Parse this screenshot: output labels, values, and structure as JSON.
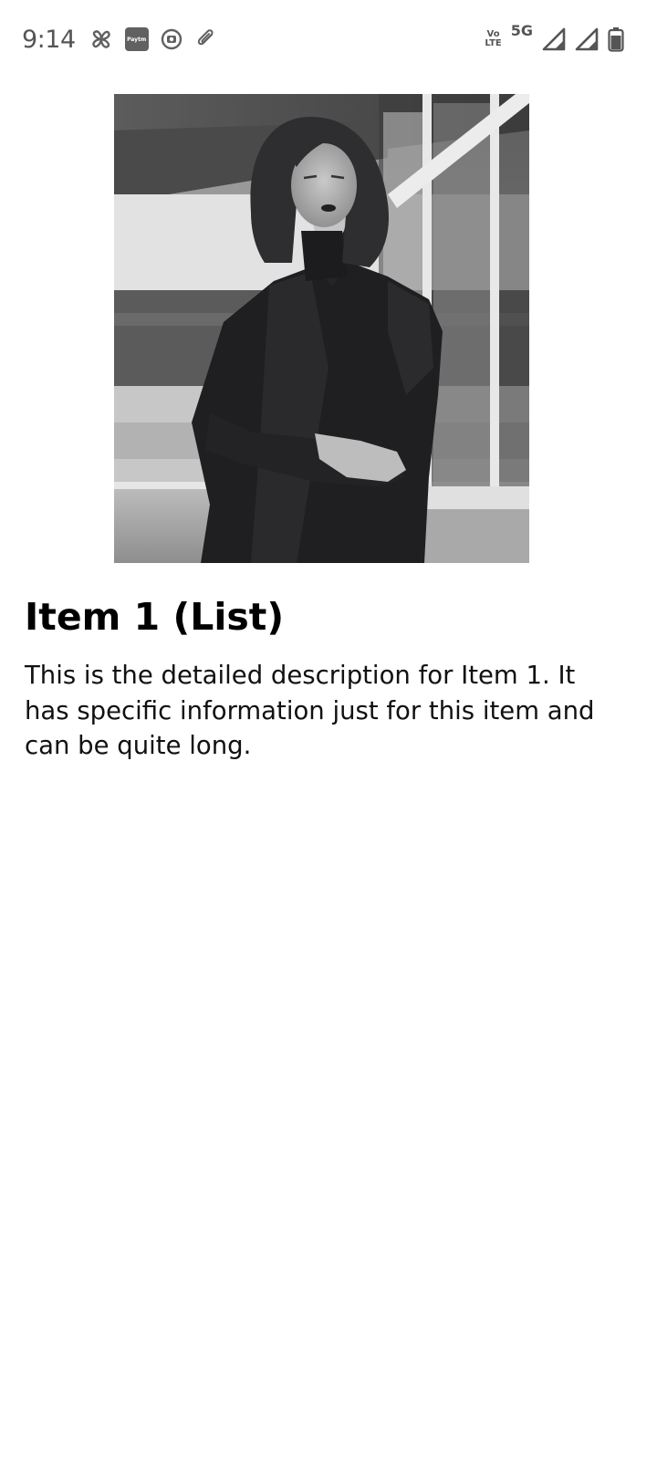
{
  "status_bar": {
    "time": "9:14",
    "left_icons": [
      "pinwheel-icon",
      "paytm-icon",
      "record-icon",
      "paperclip-icon"
    ],
    "paytm_label": "Paytm",
    "volte_top": "Vo",
    "volte_bottom": "LTE",
    "network": "5G",
    "right_icons": [
      "signal-icon",
      "signal-icon",
      "battery-icon"
    ]
  },
  "detail": {
    "title": "Item 1 (List)",
    "description": "This is the detailed description for Item 1. It has specific information just for this item and can be quite long."
  },
  "colors": {
    "background": "#ffffff",
    "status_icon": "#616161",
    "text": "#000000"
  }
}
